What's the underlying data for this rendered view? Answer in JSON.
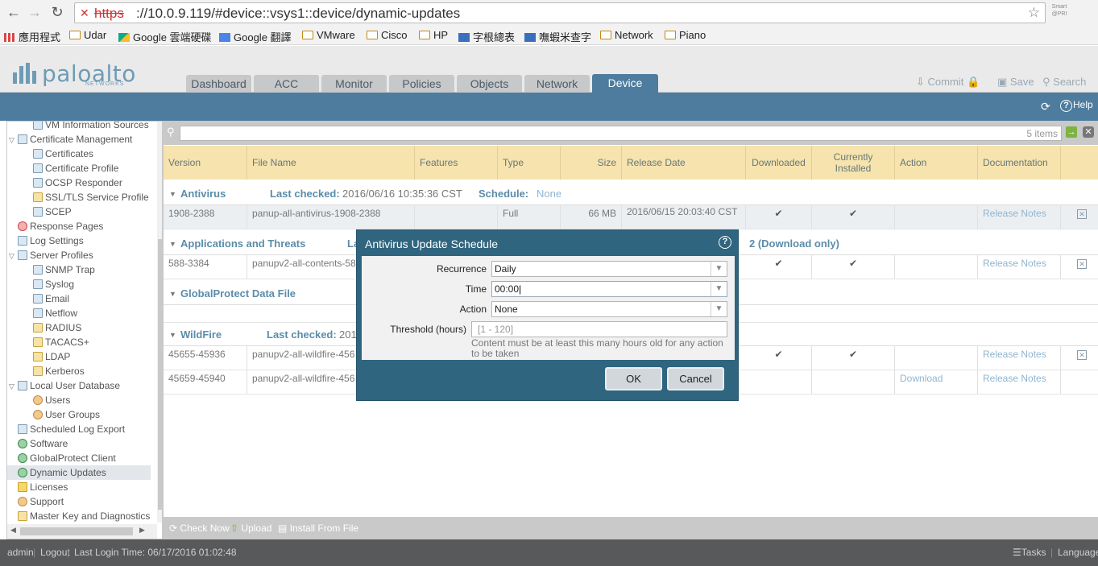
{
  "browser": {
    "url_scheme": "https",
    "url_rest": "://10.0.9.119/#device::vsys1::device/dynamic-updates",
    "extension_label": "Smart @PRI",
    "bookmarks": [
      "應用程式",
      "Udar",
      "Google 雲端硬碟",
      "Google 翻譯",
      "VMware",
      "Cisco",
      "HP",
      "字根總表",
      "嘸蝦米查字",
      "Network",
      "Piano"
    ]
  },
  "header": {
    "logo_text": "paloalto",
    "logo_sub": "NETWORKS",
    "tabs": [
      "Dashboard",
      "ACC",
      "Monitor",
      "Policies",
      "Objects",
      "Network",
      "Device"
    ],
    "active_tab": "Device",
    "commit_label": "Commit",
    "save_label": "Save",
    "search_label": "Search",
    "help_label": "Help"
  },
  "sidebar": {
    "items": [
      {
        "label": "VM Information Sources",
        "icon": "doc-icon",
        "indent": 2
      },
      {
        "label": "Certificate Management",
        "icon": "folder-icon",
        "indent": 1,
        "expanded": true
      },
      {
        "label": "Certificates",
        "icon": "doc-icon",
        "indent": 2
      },
      {
        "label": "Certificate Profile",
        "icon": "doc-icon",
        "indent": 2
      },
      {
        "label": "OCSP Responder",
        "icon": "doc-icon",
        "indent": 2
      },
      {
        "label": "SSL/TLS Service Profile",
        "icon": "lock-icon",
        "indent": 2
      },
      {
        "label": "SCEP",
        "icon": "doc-icon",
        "indent": 2
      },
      {
        "label": "Response Pages",
        "icon": "stop-icon",
        "indent": 1
      },
      {
        "label": "Log Settings",
        "icon": "doc-icon",
        "indent": 1
      },
      {
        "label": "Server Profiles",
        "icon": "folder-icon",
        "indent": 1,
        "expanded": true
      },
      {
        "label": "SNMP Trap",
        "icon": "doc-icon",
        "indent": 2
      },
      {
        "label": "Syslog",
        "icon": "doc-icon",
        "indent": 2
      },
      {
        "label": "Email",
        "icon": "doc-icon",
        "indent": 2
      },
      {
        "label": "Netflow",
        "icon": "doc-icon",
        "indent": 2
      },
      {
        "label": "RADIUS",
        "icon": "lock-icon",
        "indent": 2
      },
      {
        "label": "TACACS+",
        "icon": "lock-icon",
        "indent": 2
      },
      {
        "label": "LDAP",
        "icon": "lock-icon",
        "indent": 2
      },
      {
        "label": "Kerberos",
        "icon": "lock-icon",
        "indent": 2
      },
      {
        "label": "Local User Database",
        "icon": "folder-icon",
        "indent": 1,
        "expanded": true
      },
      {
        "label": "Users",
        "icon": "user-icon",
        "indent": 2
      },
      {
        "label": "User Groups",
        "icon": "user-icon",
        "indent": 2
      },
      {
        "label": "Scheduled Log Export",
        "icon": "doc-icon",
        "indent": 1
      },
      {
        "label": "Software",
        "icon": "globe-icon",
        "indent": 1
      },
      {
        "label": "GlobalProtect Client",
        "icon": "globe-icon",
        "indent": 1
      },
      {
        "label": "Dynamic Updates",
        "icon": "globe-icon",
        "indent": 1,
        "selected": true
      },
      {
        "label": "Licenses",
        "icon": "key-icon",
        "indent": 1
      },
      {
        "label": "Support",
        "icon": "user-icon",
        "indent": 1
      },
      {
        "label": "Master Key and Diagnostics",
        "icon": "lock-icon",
        "indent": 1
      }
    ]
  },
  "table": {
    "count_text": "5 items",
    "columns": [
      "Version",
      "File Name",
      "Features",
      "Type",
      "Size",
      "Release Date",
      "Downloaded",
      "Currently Installed",
      "Action",
      "Documentation"
    ],
    "groups": [
      {
        "name": "Antivirus",
        "last_checked_label": "Last checked:",
        "last_checked": "2016/06/16 10:35:36 CST",
        "schedule_label": "Schedule:",
        "schedule": "None"
      },
      {
        "name": "Applications and Threats",
        "last_checked_label": "La",
        "schedule_tail": "2 (Download only)"
      },
      {
        "name": "GlobalProtect Data File"
      },
      {
        "name": "WildFire",
        "last_checked_label": "Last checked:",
        "last_checked": "201"
      }
    ],
    "rows": [
      {
        "version": "1908-2388",
        "file": "panup-all-antivirus-1908-2388",
        "type": "Full",
        "size": "66 MB",
        "release": "2016/06/15 20:03:40 CST",
        "downloaded": "✔",
        "installed": "✔",
        "action": "",
        "doc": "Release Notes",
        "delete": "✕"
      },
      {
        "version": "588-3384",
        "file": "panupv2-all-contents-58",
        "downloaded": "✔",
        "installed": "✔",
        "action": "",
        "doc": "Release Notes",
        "delete": "✕"
      },
      {
        "version": "45655-45936",
        "file": "panupv2-all-wildfire-456",
        "downloaded": "✔",
        "installed": "✔",
        "action": "",
        "doc": "Release Notes",
        "delete": "✕"
      },
      {
        "version": "45659-45940",
        "file": "panupv2-all-wildfire-456",
        "downloaded": "",
        "installed": "",
        "action": "Download",
        "doc": "Release Notes",
        "delete": ""
      }
    ]
  },
  "bottom_actions": [
    "Check Now",
    "Upload",
    "Install From File"
  ],
  "status": {
    "user": "admin",
    "logout": "Logout",
    "last_login": "Last Login Time: 06/17/2016 01:02:48",
    "tasks": "Tasks",
    "language": "Language"
  },
  "modal": {
    "title": "Antivirus Update Schedule",
    "recurrence_label": "Recurrence",
    "recurrence_value": "Daily",
    "time_label": "Time",
    "time_value": "00:00",
    "action_label": "Action",
    "action_value": "None",
    "threshold_label": "Threshold (hours)",
    "threshold_placeholder": "[1 - 120]",
    "threshold_hint": "Content must be at least this many hours old for any action to be taken",
    "ok_label": "OK",
    "cancel_label": "Cancel"
  },
  "colors": {
    "accent_blue": "#4d7c9e",
    "modal_blue": "#30657f",
    "header_yellow": "#f6e3ae",
    "link_blue": "#8fb5cf"
  }
}
